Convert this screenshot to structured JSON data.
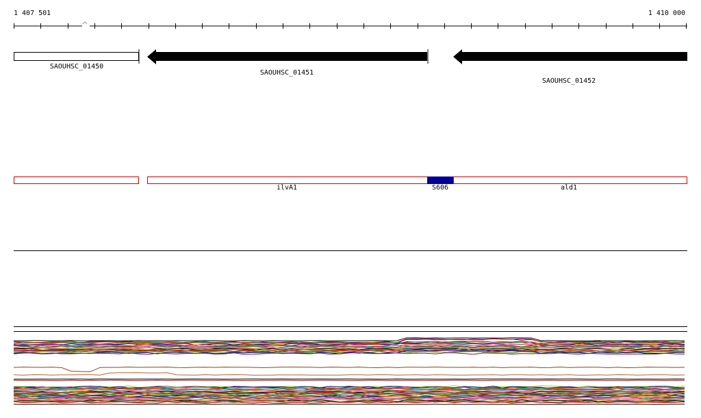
{
  "coordinates": {
    "start_label": "1 407 501",
    "end_label": "1 410 000"
  },
  "genes": [
    {
      "id": "SAOUHSC_01450",
      "strand": "none",
      "fill": "#ffffff"
    },
    {
      "id": "SAOUHSC_01451",
      "strand": "minus",
      "fill": "#000000"
    },
    {
      "id": "SAOUHSC_01452",
      "strand": "minus",
      "fill": "#000000"
    }
  ],
  "annotations": [
    {
      "name": "",
      "color": "#d00000"
    },
    {
      "name": "ilvA1",
      "color": "#d00000"
    },
    {
      "name": "S606",
      "color": "#000099"
    },
    {
      "name": "ald1",
      "color": "#d00000"
    }
  ],
  "colors": {
    "axis": "#000000",
    "annotation_outline": "#d00000",
    "highlight": "#000099",
    "profile_palette": [
      "#c00000",
      "#8b4513",
      "#2e8b57",
      "#9acd32",
      "#000080",
      "#800080",
      "#ff8c00",
      "#008b8b",
      "#b22222",
      "#556b2f",
      "#ff69b4",
      "#4682b4",
      "#daa520",
      "#000000",
      "#a52a2a",
      "#6b8e23"
    ]
  }
}
